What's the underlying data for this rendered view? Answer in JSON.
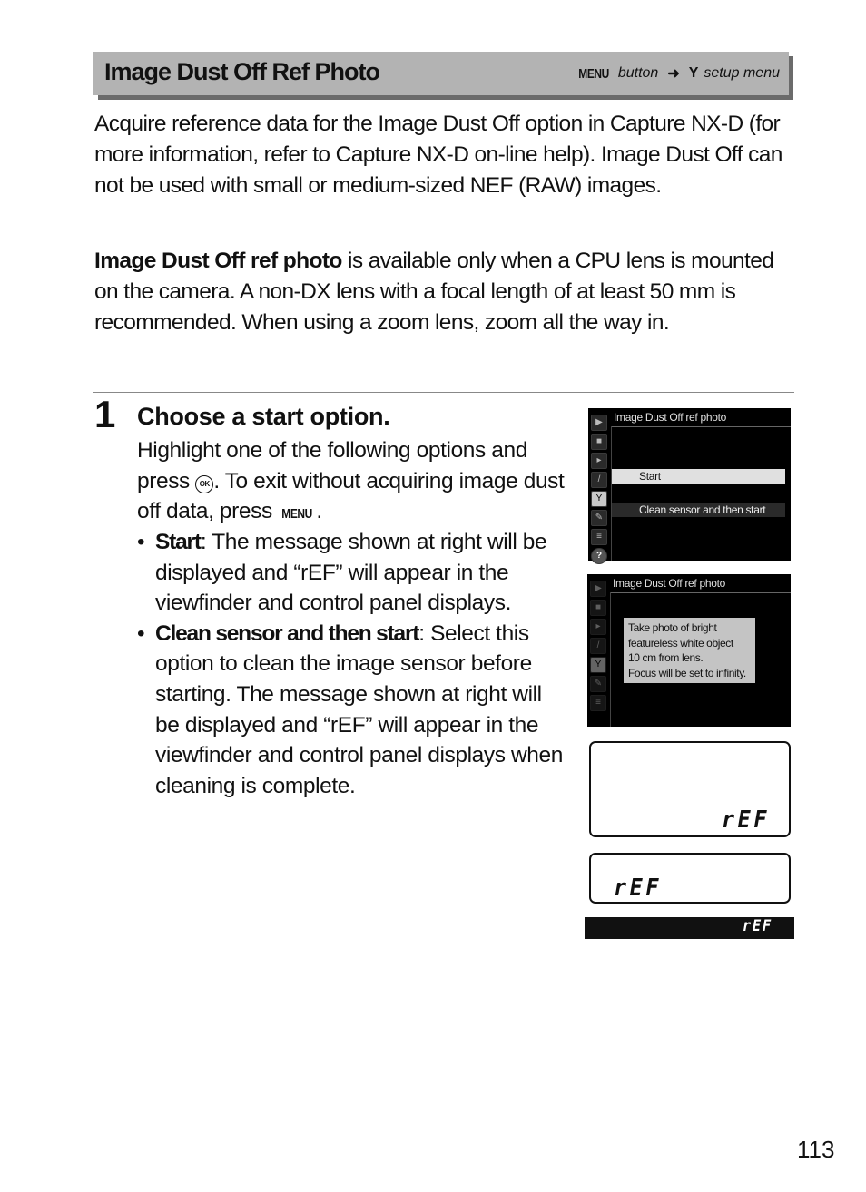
{
  "header": {
    "title": "Image Dust Off Ref Photo",
    "nav_menu": "MENU",
    "nav_button": "button",
    "nav_arrow": "➜",
    "nav_icon": "wrench-icon",
    "nav_wrench_glyph": "Y",
    "nav_setup": "setup menu"
  },
  "intro": {
    "para1": "Acquire reference data for the Image Dust Off option in Capture NX-D (for more information, refer to Capture NX-D on-line help).  Image Dust Off can not be used with small or medium-sized NEF (RAW) images.",
    "para2_bold": "Image Dust Off ref photo",
    "para2_rest": " is available only when a CPU lens is mounted on the camera.  A non-DX lens with a focal length of at least 50 mm is recommended.  When using a zoom lens, zoom all the way in."
  },
  "step": {
    "number": "1",
    "title": "Choose a start option.",
    "body_a": "Highlight one of the following options and press ",
    "ok_glyph": "OK",
    "body_b": ".  To exit without acquiring image dust off data, press ",
    "menu_glyph": "MENU",
    "body_c": ".",
    "bullets": [
      {
        "dot": "•",
        "term": "Start",
        "text": ": The message shown at right will be displayed and “rEF” will appear in the viewfinder and control panel displays."
      },
      {
        "dot": "•",
        "term": "Clean sensor and then start",
        "text": ": Select this option to clean the image sensor before starting.  The message shown at right will be displayed and “rEF” will appear in the viewfinder and control panel displays when cleaning is complete."
      }
    ]
  },
  "camera_screen_1": {
    "title": "Image Dust Off ref photo",
    "options": [
      "Start",
      "Clean sensor and then start"
    ],
    "selected": "Start",
    "side_icons": [
      {
        "name": "playback-icon",
        "glyph": "▶"
      },
      {
        "name": "camera-icon",
        "glyph": "■"
      },
      {
        "name": "movie-icon",
        "glyph": "▸"
      },
      {
        "name": "pencil-icon",
        "glyph": "/"
      },
      {
        "name": "wrench-icon",
        "glyph": "Y"
      },
      {
        "name": "retouch-icon",
        "glyph": "✎"
      },
      {
        "name": "my-menu-icon",
        "glyph": "≡"
      },
      {
        "name": "help-icon",
        "glyph": "?"
      }
    ]
  },
  "camera_screen_2": {
    "title": "Image Dust Off ref photo",
    "message": [
      "Take photo of bright",
      "featureless white object",
      "10 cm from lens.",
      "Focus will be set to infinity."
    ],
    "side_icons": [
      {
        "name": "playback-icon",
        "glyph": "▶"
      },
      {
        "name": "camera-icon",
        "glyph": "■"
      },
      {
        "name": "movie-icon",
        "glyph": "▸"
      },
      {
        "name": "pencil-icon",
        "glyph": "/"
      },
      {
        "name": "wrench-icon",
        "glyph": "Y"
      },
      {
        "name": "retouch-icon",
        "glyph": "✎"
      },
      {
        "name": "my-menu-icon",
        "glyph": "≡"
      }
    ]
  },
  "control_panel_1": {
    "readout": "rEF"
  },
  "control_panel_2": {
    "readout": "rEF"
  },
  "viewfinder": {
    "readout": "rEF"
  },
  "page_number": "113"
}
